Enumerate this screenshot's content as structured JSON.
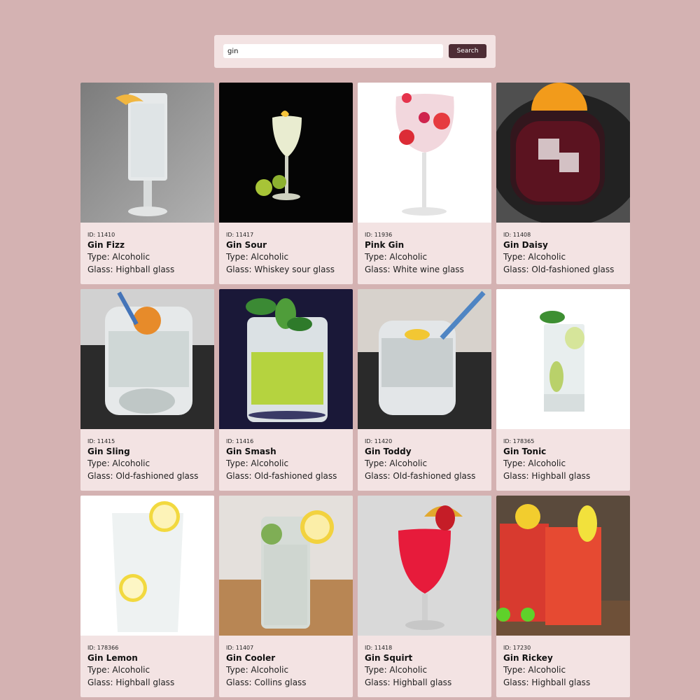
{
  "search": {
    "value": "gin",
    "button_label": "Search"
  },
  "drinks": [
    {
      "id": "11410",
      "name": "Gin Fizz",
      "type": "Alcoholic",
      "glass": "Highball glass"
    },
    {
      "id": "11417",
      "name": "Gin Sour",
      "type": "Alcoholic",
      "glass": "Whiskey sour glass"
    },
    {
      "id": "11936",
      "name": "Pink Gin",
      "type": "Alcoholic",
      "glass": "White wine glass"
    },
    {
      "id": "11408",
      "name": "Gin Daisy",
      "type": "Alcoholic",
      "glass": "Old-fashioned glass"
    },
    {
      "id": "11415",
      "name": "Gin Sling",
      "type": "Alcoholic",
      "glass": "Old-fashioned glass"
    },
    {
      "id": "11416",
      "name": "Gin Smash",
      "type": "Alcoholic",
      "glass": "Old-fashioned glass"
    },
    {
      "id": "11420",
      "name": "Gin Toddy",
      "type": "Alcoholic",
      "glass": "Old-fashioned glass"
    },
    {
      "id": "178365",
      "name": "Gin Tonic",
      "type": "Alcoholic",
      "glass": "Highball glass"
    },
    {
      "id": "178366",
      "name": "Gin Lemon",
      "type": "Alcoholic",
      "glass": "Highball glass"
    },
    {
      "id": "11407",
      "name": "Gin Cooler",
      "type": "Alcoholic",
      "glass": "Collins glass"
    },
    {
      "id": "11418",
      "name": "Gin Squirt",
      "type": "Alcoholic",
      "glass": "Highball glass"
    },
    {
      "id": "17230",
      "name": "Gin Rickey",
      "type": "Alcoholic",
      "glass": "Highball glass"
    }
  ],
  "labels": {
    "id_prefix": "ID: ",
    "type_prefix": "Type: ",
    "glass_prefix": "Glass: "
  },
  "colors": {
    "background": "#d4b2b2",
    "panel": "#f3e3e3",
    "button": "#4e2d35"
  }
}
